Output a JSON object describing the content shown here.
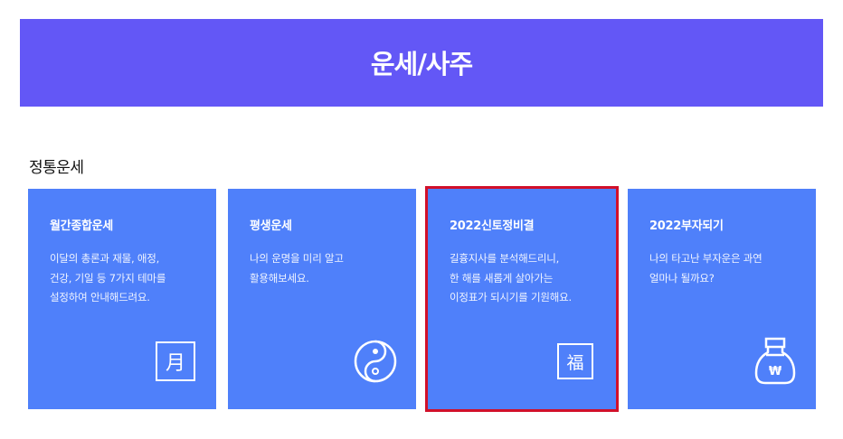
{
  "header": {
    "title": "운세/사주"
  },
  "section": {
    "title": "정통운세"
  },
  "cards": [
    {
      "title": "월간종합운세",
      "desc": [
        "이달의 총론과 재물, 애정,",
        "건강, 기일 등 7가지 테마를",
        "설정하여 안내해드려요."
      ],
      "icon": "moon-character-icon",
      "glyph": "月"
    },
    {
      "title": "평생운세",
      "desc": [
        "나의 운명을 미리 알고",
        "활용해보세요."
      ],
      "icon": "yin-yang-icon"
    },
    {
      "title": "2022신토정비결",
      "desc": [
        "길흉지사를 분석해드리니,",
        "한 해를 새롭게 살아가는",
        "이정표가 되시기를 기원해요."
      ],
      "icon": "fortune-character-icon",
      "glyph": "福"
    },
    {
      "title": "2022부자되기",
      "desc": [
        "나의 타고난 부자운은 과연",
        "얼마나 될까요?"
      ],
      "icon": "money-bag-icon",
      "glyph": "₩"
    }
  ],
  "colors": {
    "banner": "#6357f6",
    "card": "#4f80fa",
    "selected_outline": "#d1102a"
  }
}
